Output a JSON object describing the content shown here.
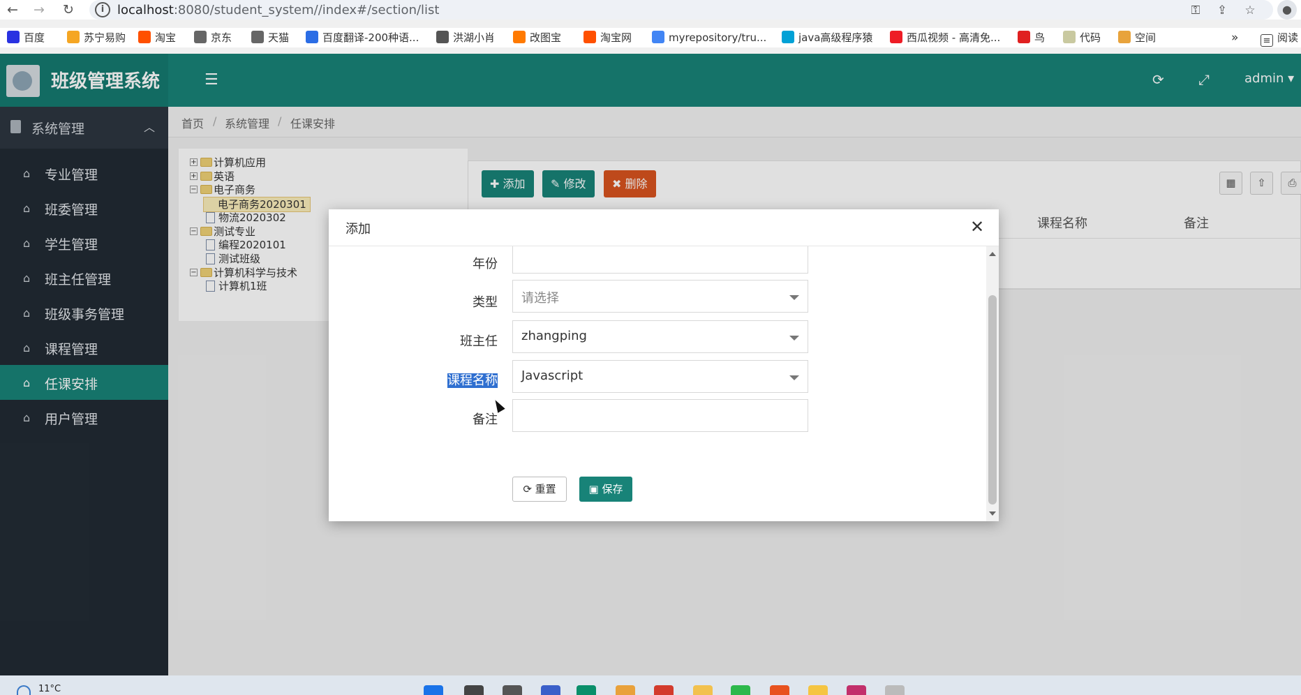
{
  "browser": {
    "url_host": "localhost",
    "url_rest": ":8080/student_system//index#/section/list",
    "bookmarks": [
      {
        "label": "百度",
        "icon": "baidu-icon",
        "color": "#2932e1"
      },
      {
        "label": "苏宁易购",
        "icon": "suning-icon",
        "color": "#f5a623"
      },
      {
        "label": "淘宝",
        "icon": "taobao-icon",
        "color": "#ff5000"
      },
      {
        "label": "京东",
        "icon": "globe-icon",
        "color": "#666666"
      },
      {
        "label": "天猫",
        "icon": "globe-icon",
        "color": "#666666"
      },
      {
        "label": "百度翻译-200种语...",
        "icon": "translate-icon",
        "color": "#2b6de5"
      },
      {
        "label": "洪湖小肖",
        "icon": "bird-icon",
        "color": "#555555"
      },
      {
        "label": "改图宝",
        "icon": "image-icon",
        "color": "#ff7a00"
      },
      {
        "label": "淘宝网",
        "icon": "taobao-icon",
        "color": "#ff5000"
      },
      {
        "label": "myrepository/tru...",
        "icon": "chrome-icon",
        "color": "#4285f4"
      },
      {
        "label": "java高级程序猿",
        "icon": "bilibili-icon",
        "color": "#00a1d6"
      },
      {
        "label": "西瓜视频 - 高清免...",
        "icon": "xigua-icon",
        "color": "#ee1c25"
      },
      {
        "label": "鸟",
        "icon": "bird-red-icon",
        "color": "#e02020"
      },
      {
        "label": "代码",
        "icon": "code-icon",
        "color": "#c9c9a0"
      },
      {
        "label": "空间",
        "icon": "qzone-icon",
        "color": "#e8a33c"
      }
    ],
    "more_label": "»",
    "reading_label": "阅读"
  },
  "app": {
    "title": "班级管理系统",
    "user": "admin",
    "brand_color": "#188378"
  },
  "sidebar": {
    "group_label": "系统管理",
    "items": [
      {
        "label": "专业管理",
        "active": false
      },
      {
        "label": "班委管理",
        "active": false
      },
      {
        "label": "学生管理",
        "active": false
      },
      {
        "label": "班主任管理",
        "active": false
      },
      {
        "label": "班级事务管理",
        "active": false
      },
      {
        "label": "课程管理",
        "active": false
      },
      {
        "label": "任课安排",
        "active": true
      },
      {
        "label": "用户管理",
        "active": false
      }
    ]
  },
  "breadcrumb": [
    "首页",
    "系统管理",
    "任课安排"
  ],
  "tree": [
    {
      "label": "计算机应用",
      "type": "folder",
      "expanded": false,
      "level": 0
    },
    {
      "label": "英语",
      "type": "folder",
      "expanded": false,
      "level": 0
    },
    {
      "label": "电子商务",
      "type": "folder",
      "expanded": true,
      "level": 0
    },
    {
      "label": "电子商务2020301",
      "type": "file",
      "selected": true,
      "level": 1
    },
    {
      "label": "物流2020302",
      "type": "file",
      "level": 1
    },
    {
      "label": "测试专业",
      "type": "folder",
      "expanded": true,
      "level": 0
    },
    {
      "label": "编程2020101",
      "type": "file",
      "level": 1
    },
    {
      "label": "测试班级",
      "type": "file",
      "level": 1
    },
    {
      "label": "计算机科学与技术",
      "type": "folder",
      "expanded": true,
      "level": 0
    },
    {
      "label": "计算机1班",
      "type": "file",
      "level": 1
    }
  ],
  "toolbar": {
    "add_label": "添加",
    "edit_label": "修改",
    "delete_label": "删除"
  },
  "table": {
    "columns": [
      "课程名称",
      "备注"
    ]
  },
  "modal": {
    "title": "添加",
    "fields": {
      "year_label": "年份",
      "year_value": "",
      "type_label": "类型",
      "type_placeholder": "请选择",
      "teacher_label": "班主任",
      "teacher_value": "zhangping",
      "course_label": "课程名称",
      "course_value": "Javascript",
      "remark_label": "备注",
      "remark_value": ""
    },
    "reset_label": "重置",
    "save_label": "保存"
  },
  "taskbar": {
    "weather": "11°C"
  }
}
